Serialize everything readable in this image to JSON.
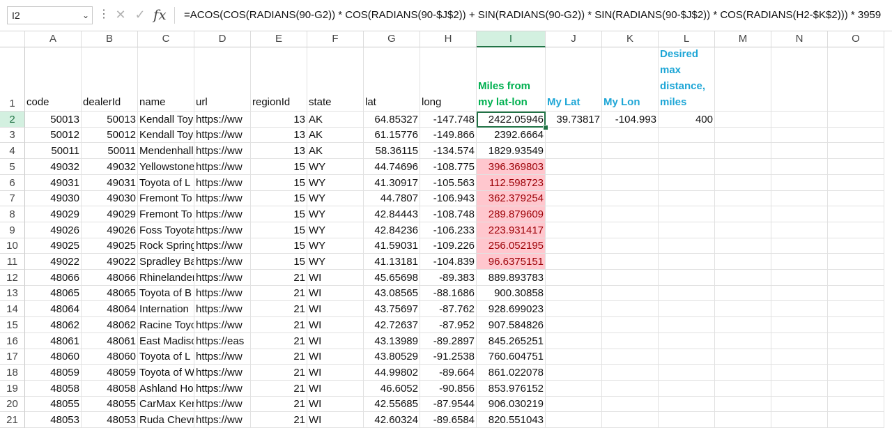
{
  "formula_bar": {
    "name_box": "I2",
    "formula": "=ACOS(COS(RADIANS(90-G2)) * COS(RADIANS(90-$J$2)) + SIN(RADIANS(90-G2)) * SIN(RADIANS(90-$J$2)) * COS(RADIANS(H2-$K$2))) * 3959"
  },
  "columns": [
    "A",
    "B",
    "C",
    "D",
    "E",
    "F",
    "G",
    "H",
    "I",
    "J",
    "K",
    "L",
    "M",
    "N",
    "O"
  ],
  "header_row": {
    "row_number": "1",
    "cells": [
      "code",
      "dealerId",
      "name",
      "url",
      "regionId",
      "state",
      "lat",
      "long",
      "Miles from my lat-lon",
      "My Lat",
      "My Lon",
      "Desired max distance, miles",
      "",
      "",
      ""
    ]
  },
  "rows": [
    {
      "n": "2",
      "cells": [
        "50013",
        "50013",
        "Kendall Toyota",
        "https://ww",
        "13",
        "AK",
        "64.85327",
        "-147.748",
        "2422.05946",
        "39.73817",
        "-104.993",
        "400"
      ]
    },
    {
      "n": "3",
      "cells": [
        "50012",
        "50012",
        "Kendall Toyota",
        "https://ww",
        "13",
        "AK",
        "61.15776",
        "-149.866",
        "2392.6664",
        "",
        "",
        ""
      ]
    },
    {
      "n": "4",
      "cells": [
        "50011",
        "50011",
        "Mendenhall",
        "https://ww",
        "13",
        "AK",
        "58.36115",
        "-134.574",
        "1829.93549",
        "",
        "",
        ""
      ]
    },
    {
      "n": "5",
      "cells": [
        "49032",
        "49032",
        "Yellowstone",
        "https://ww",
        "15",
        "WY",
        "44.74696",
        "-108.775",
        "396.369803",
        "",
        "",
        ""
      ]
    },
    {
      "n": "6",
      "cells": [
        "49031",
        "49031",
        "Toyota of L",
        "https://ww",
        "15",
        "WY",
        "41.30917",
        "-105.563",
        "112.598723",
        "",
        "",
        ""
      ]
    },
    {
      "n": "7",
      "cells": [
        "49030",
        "49030",
        "Fremont To",
        "https://ww",
        "15",
        "WY",
        "44.7807",
        "-106.943",
        "362.379254",
        "",
        "",
        ""
      ]
    },
    {
      "n": "8",
      "cells": [
        "49029",
        "49029",
        "Fremont To",
        "https://ww",
        "15",
        "WY",
        "42.84443",
        "-108.748",
        "289.879609",
        "",
        "",
        ""
      ]
    },
    {
      "n": "9",
      "cells": [
        "49026",
        "49026",
        "Foss Toyota",
        "https://ww",
        "15",
        "WY",
        "42.84236",
        "-106.233",
        "223.931417",
        "",
        "",
        ""
      ]
    },
    {
      "n": "10",
      "cells": [
        "49025",
        "49025",
        "Rock Spring",
        "https://ww",
        "15",
        "WY",
        "41.59031",
        "-109.226",
        "256.052195",
        "",
        "",
        ""
      ]
    },
    {
      "n": "11",
      "cells": [
        "49022",
        "49022",
        "Spradley Ba",
        "https://ww",
        "15",
        "WY",
        "41.13181",
        "-104.839",
        "96.6375151",
        "",
        "",
        ""
      ]
    },
    {
      "n": "12",
      "cells": [
        "48066",
        "48066",
        "Rhinelander",
        "https://ww",
        "21",
        "WI",
        "45.65698",
        "-89.383",
        "889.893783",
        "",
        "",
        ""
      ]
    },
    {
      "n": "13",
      "cells": [
        "48065",
        "48065",
        "Toyota of B",
        "https://ww",
        "21",
        "WI",
        "43.08565",
        "-88.1686",
        "900.30858",
        "",
        "",
        ""
      ]
    },
    {
      "n": "14",
      "cells": [
        "48064",
        "48064",
        "Internation",
        "https://ww",
        "21",
        "WI",
        "43.75697",
        "-87.762",
        "928.699023",
        "",
        "",
        ""
      ]
    },
    {
      "n": "15",
      "cells": [
        "48062",
        "48062",
        "Racine Toyo",
        "https://ww",
        "21",
        "WI",
        "42.72637",
        "-87.952",
        "907.584826",
        "",
        "",
        ""
      ]
    },
    {
      "n": "16",
      "cells": [
        "48061",
        "48061",
        "East Madiso",
        "https://eas",
        "21",
        "WI",
        "43.13989",
        "-89.2897",
        "845.265251",
        "",
        "",
        ""
      ]
    },
    {
      "n": "17",
      "cells": [
        "48060",
        "48060",
        "Toyota of L",
        "https://ww",
        "21",
        "WI",
        "43.80529",
        "-91.2538",
        "760.604751",
        "",
        "",
        ""
      ]
    },
    {
      "n": "18",
      "cells": [
        "48059",
        "48059",
        "Toyota of W",
        "https://ww",
        "21",
        "WI",
        "44.99802",
        "-89.664",
        "861.022078",
        "",
        "",
        ""
      ]
    },
    {
      "n": "19",
      "cells": [
        "48058",
        "48058",
        "Ashland Ho",
        "https://ww",
        "21",
        "WI",
        "46.6052",
        "-90.856",
        "853.976152",
        "",
        "",
        ""
      ]
    },
    {
      "n": "20",
      "cells": [
        "48055",
        "48055",
        "CarMax Ken",
        "https://ww",
        "21",
        "WI",
        "42.55685",
        "-87.9544",
        "906.030219",
        "",
        "",
        ""
      ]
    },
    {
      "n": "21",
      "cells": [
        "48053",
        "48053",
        "Ruda Chevr",
        "https://ww",
        "21",
        "WI",
        "42.60324",
        "-89.6584",
        "820.551043",
        "",
        "",
        ""
      ]
    }
  ],
  "colors": {
    "accent": "#217346",
    "highlight_fill": "#ffc7ce",
    "highlight_text": "#9c0006",
    "green_header": "#00b050",
    "blue_header": "#1ea6d6"
  },
  "icons": {
    "cancel": "x-icon",
    "enter": "check-icon",
    "function": "fx-icon"
  }
}
